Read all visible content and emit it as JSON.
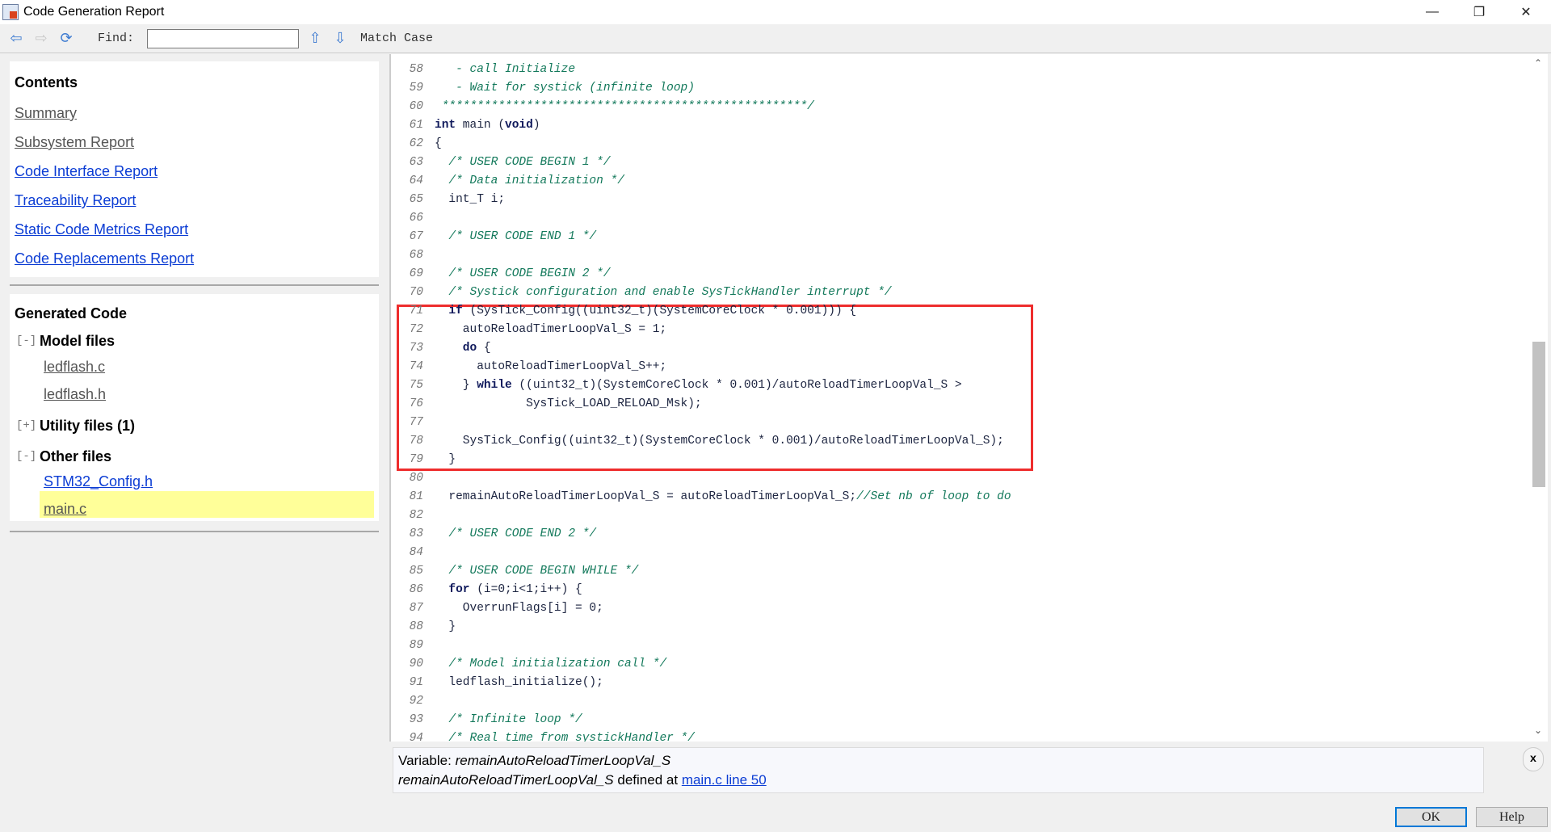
{
  "window": {
    "title": "Code Generation Report",
    "icon": "simulink-report-icon"
  },
  "toolbar": {
    "back_icon": "arrow-left-icon",
    "forward_icon": "arrow-right-icon",
    "refresh_icon": "refresh-icon",
    "find_label": "Find:",
    "find_value": "",
    "up_icon": "arrow-up-icon",
    "down_icon": "arrow-down-icon",
    "match_case": "Match Case"
  },
  "contents": {
    "heading": "Contents",
    "links": [
      {
        "label": "Summary",
        "visited": true
      },
      {
        "label": "Subsystem Report",
        "visited": true
      },
      {
        "label": "Code Interface Report",
        "visited": false
      },
      {
        "label": "Traceability Report",
        "visited": false
      },
      {
        "label": "Static Code Metrics Report",
        "visited": false
      },
      {
        "label": "Code Replacements Report",
        "visited": false
      }
    ]
  },
  "generated": {
    "heading": "Generated Code",
    "groups": [
      {
        "toggle": "[-]",
        "label": "Model files",
        "files": [
          "ledflash.c",
          "ledflash.h"
        ]
      },
      {
        "toggle": "[+]",
        "label": "Utility files (1)",
        "files": []
      },
      {
        "toggle": "[-]",
        "label": "Other files",
        "files": [
          "STM32_Config.h",
          "main.c"
        ]
      }
    ],
    "selected_file": "main.c",
    "highlight_color": "#ffff99"
  },
  "code": {
    "lines": [
      {
        "n": "58",
        "s": [
          [
            "cm",
            "   - call Initialize"
          ]
        ]
      },
      {
        "n": "59",
        "s": [
          [
            "cm",
            "   - Wait for systick (infinite loop)"
          ]
        ]
      },
      {
        "n": "60",
        "s": [
          [
            "cm",
            " ****************************************************/"
          ]
        ]
      },
      {
        "n": "61",
        "s": [
          [
            "kw",
            "int"
          ],
          [
            "tx",
            " main ("
          ],
          [
            "kw",
            "void"
          ],
          [
            "tx",
            ")"
          ]
        ]
      },
      {
        "n": "62",
        "s": [
          [
            "tx",
            "{"
          ]
        ]
      },
      {
        "n": "63",
        "s": [
          [
            "cm",
            "  /* USER CODE BEGIN 1 */"
          ]
        ]
      },
      {
        "n": "64",
        "s": [
          [
            "cm",
            "  /* Data initialization */"
          ]
        ]
      },
      {
        "n": "65",
        "s": [
          [
            "tx",
            "  int_T i;"
          ]
        ]
      },
      {
        "n": "66",
        "s": []
      },
      {
        "n": "67",
        "s": [
          [
            "cm",
            "  /* USER CODE END 1 */"
          ]
        ]
      },
      {
        "n": "68",
        "s": []
      },
      {
        "n": "69",
        "s": [
          [
            "cm",
            "  /* USER CODE BEGIN 2 */"
          ]
        ]
      },
      {
        "n": "70",
        "s": [
          [
            "cm",
            "  /* Systick configuration and enable SysTickHandler interrupt */"
          ]
        ]
      },
      {
        "n": "71",
        "s": [
          [
            "kw",
            "  if"
          ],
          [
            "tx",
            " (SysTick_Config((uint32_t)(SystemCoreClock * 0.001))) {"
          ]
        ]
      },
      {
        "n": "72",
        "s": [
          [
            "tx",
            "    autoReloadTimerLoopVal_S = 1;"
          ]
        ]
      },
      {
        "n": "73",
        "s": [
          [
            "kw",
            "    do"
          ],
          [
            "tx",
            " {"
          ]
        ]
      },
      {
        "n": "74",
        "s": [
          [
            "tx",
            "      autoReloadTimerLoopVal_S++;"
          ]
        ]
      },
      {
        "n": "75",
        "s": [
          [
            "tx",
            "    } "
          ],
          [
            "kw",
            "while"
          ],
          [
            "tx",
            " ((uint32_t)(SystemCoreClock * 0.001)/autoReloadTimerLoopVal_S >"
          ]
        ]
      },
      {
        "n": "76",
        "s": [
          [
            "tx",
            "             SysTick_LOAD_RELOAD_Msk);"
          ]
        ]
      },
      {
        "n": "77",
        "s": []
      },
      {
        "n": "78",
        "s": [
          [
            "tx",
            "    SysTick_Config((uint32_t)(SystemCoreClock * 0.001)/autoReloadTimerLoopVal_S);"
          ]
        ]
      },
      {
        "n": "79",
        "s": [
          [
            "tx",
            "  }"
          ]
        ]
      },
      {
        "n": "80",
        "s": []
      },
      {
        "n": "81",
        "s": [
          [
            "tx",
            "  remainAutoReloadTimerLoopVal_S = autoReloadTimerLoopVal_S;"
          ],
          [
            "cm",
            "//Set nb of loop to do"
          ]
        ]
      },
      {
        "n": "82",
        "s": []
      },
      {
        "n": "83",
        "s": [
          [
            "cm",
            "  /* USER CODE END 2 */"
          ]
        ]
      },
      {
        "n": "84",
        "s": []
      },
      {
        "n": "85",
        "s": [
          [
            "cm",
            "  /* USER CODE BEGIN WHILE */"
          ]
        ]
      },
      {
        "n": "86",
        "s": [
          [
            "kw",
            "  for"
          ],
          [
            "tx",
            " (i=0;i<1;i++) {"
          ]
        ]
      },
      {
        "n": "87",
        "s": [
          [
            "tx",
            "    OverrunFlags[i] = 0;"
          ]
        ]
      },
      {
        "n": "88",
        "s": [
          [
            "tx",
            "  }"
          ]
        ]
      },
      {
        "n": "89",
        "s": []
      },
      {
        "n": "90",
        "s": [
          [
            "cm",
            "  /* Model initialization call */"
          ]
        ]
      },
      {
        "n": "91",
        "s": [
          [
            "tx",
            "  ledflash_initialize();"
          ]
        ]
      },
      {
        "n": "92",
        "s": []
      },
      {
        "n": "93",
        "s": [
          [
            "cm",
            "  /* Infinite loop */"
          ]
        ]
      },
      {
        "n": "94",
        "s": [
          [
            "cm",
            "  /* Real time from systickHandler */"
          ]
        ]
      }
    ],
    "highlight_color": "#ee2d2d"
  },
  "info": {
    "variable_label": "Variable:",
    "variable_name": "remainAutoReloadTimerLoopVal_S",
    "def_name": "remainAutoReloadTimerLoopVal_S",
    "def_text": "defined at",
    "def_link": "main.c line 50",
    "close": "x"
  },
  "buttons": {
    "ok": "OK",
    "help": "Help"
  }
}
